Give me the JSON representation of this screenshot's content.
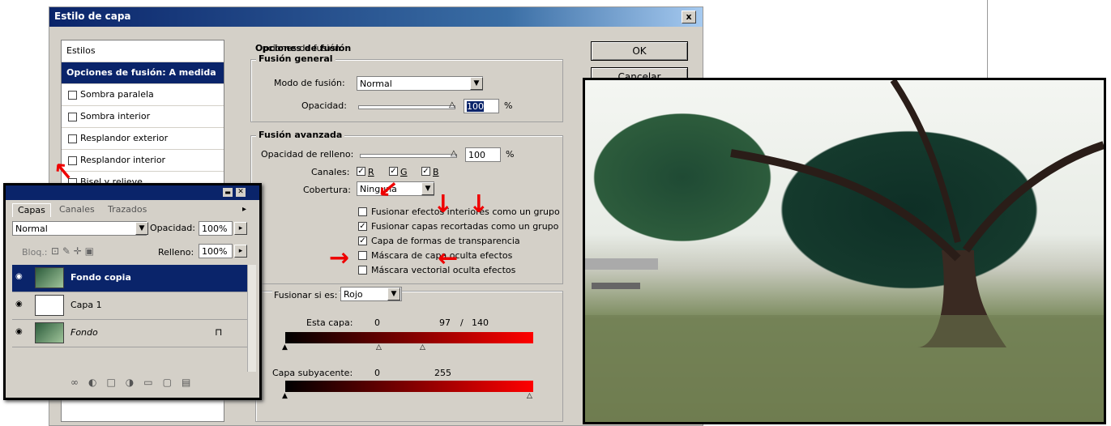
{
  "dialog": {
    "title": "Estilo de capa",
    "close": "x",
    "ok": "OK",
    "cancel": "Cancelar",
    "styles": [
      {
        "label": "Estilos",
        "type": "header"
      },
      {
        "label": "Opciones de fusión: A medida",
        "type": "selected"
      },
      {
        "label": "Sombra paralela",
        "type": "check"
      },
      {
        "label": "Sombra interior",
        "type": "check"
      },
      {
        "label": "Resplandor exterior",
        "type": "check"
      },
      {
        "label": "Resplandor interior",
        "type": "check"
      },
      {
        "label": "Bisel y relieve",
        "type": "check"
      }
    ]
  },
  "blend": {
    "section": "Opciones de fusión",
    "general": "Fusión general",
    "mode_label": "Modo de fusión:",
    "mode_value": "Normal",
    "opacity_label": "Opacidad:",
    "opacity_value": "100",
    "opacity_unit": "%",
    "advanced": "Fusión avanzada",
    "fill_label": "Opacidad de relleno:",
    "fill_value": "100",
    "fill_unit": "%",
    "channels_label": "Canales:",
    "channels": [
      "R",
      "G",
      "B"
    ],
    "knockout_label": "Cobertura:",
    "knockout_value": "Ninguna",
    "options": [
      {
        "label": "Fusionar efectos interiores como un grupo",
        "checked": false
      },
      {
        "label": "Fusionar capas recortadas como un grupo",
        "checked": true
      },
      {
        "label": "Capa de formas de transparencia",
        "checked": true
      },
      {
        "label": "Máscara de capa oculta efectos",
        "checked": false
      },
      {
        "label": "Máscara vectorial oculta efectos",
        "checked": false
      }
    ],
    "blendif_label": "Fusionar si es:",
    "blendif_value": "Rojo",
    "this_layer_label": "Esta capa:",
    "this_layer_min": "0",
    "this_layer_mid": "97",
    "this_layer_sep": "/",
    "this_layer_max": "140",
    "underlying_label": "Capa subyacente:",
    "underlying_min": "0",
    "underlying_max": "255"
  },
  "layers_panel": {
    "tabs": [
      "Capas",
      "Canales",
      "Trazados"
    ],
    "mode_value": "Normal",
    "opacity_label": "Opacidad:",
    "opacity_value": "100%",
    "lock_label": "Bloq.:",
    "fill_label": "Relleno:",
    "fill_value": "100%",
    "layers": [
      {
        "name": "Fondo copia",
        "selected": true
      },
      {
        "name": "Capa 1",
        "selected": false
      },
      {
        "name": "Fondo",
        "selected": false
      }
    ]
  },
  "colors": {
    "accent": "#0a246a",
    "arrow": "#e00000"
  }
}
